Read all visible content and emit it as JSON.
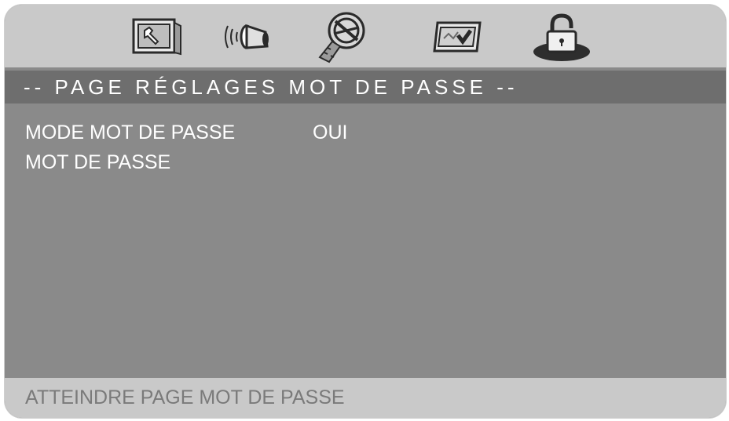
{
  "tabs": [
    {
      "name": "general-setup",
      "icon": "wrench-monitor-icon"
    },
    {
      "name": "audio-setup",
      "icon": "speaker-icon"
    },
    {
      "name": "video-setup",
      "icon": "film-reel-icon"
    },
    {
      "name": "preference-setup",
      "icon": "checkmark-panel-icon"
    },
    {
      "name": "password-setup",
      "icon": "padlock-icon",
      "selected": true
    }
  ],
  "header": {
    "title": "-- PAGE RÉGLAGES MOT DE PASSE --"
  },
  "settings": [
    {
      "label": "MODE MOT DE PASSE",
      "value": "OUI"
    },
    {
      "label": "MOT DE PASSE",
      "value": ""
    }
  ],
  "status_bar": {
    "text": "ATTEINDRE PAGE MOT DE PASSE"
  },
  "colors": {
    "background": "#8a8a8a",
    "icon_bar": "#c9c9c9",
    "header_bar": "#6e6e6e",
    "text": "#ffffff",
    "status_text": "#7a7a7a"
  }
}
